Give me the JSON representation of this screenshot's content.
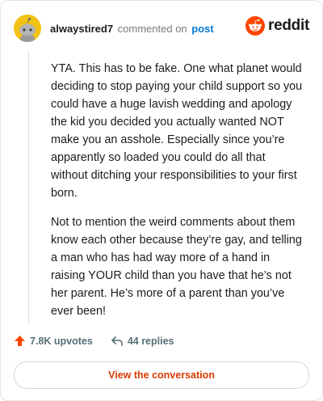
{
  "header": {
    "username": "alwaystired7",
    "verb": "commented on",
    "post_link": "post",
    "brand": "reddit"
  },
  "comment": {
    "paragraphs": [
      "YTA. This has to be fake. One what planet would deciding to stop paying your child support so you could have a huge lavish wedding and apology the kid you decided you actually wanted NOT make you an asshole. Especially since you’re apparently so loaded you could do all that without ditching your responsibilities to your first born.",
      "Not to mention the weird comments about them know each other because they’re gay, and telling a man who has had way more of a hand in raising YOUR child than you have that he’s not her parent. He’s more of a parent than you’ve ever been!"
    ]
  },
  "actions": {
    "upvotes": "7.8K upvotes",
    "replies": "44 replies"
  },
  "cta": {
    "label": "View the conversation"
  },
  "colors": {
    "accent": "#ff4500",
    "link": "#0079d3",
    "cta_text": "#d93a00",
    "avatar_bg": "#f2c316"
  },
  "icons": [
    "snoo-avatar-icon",
    "reddit-logo-icon",
    "upvote-arrow-icon",
    "reply-arrow-icon"
  ]
}
